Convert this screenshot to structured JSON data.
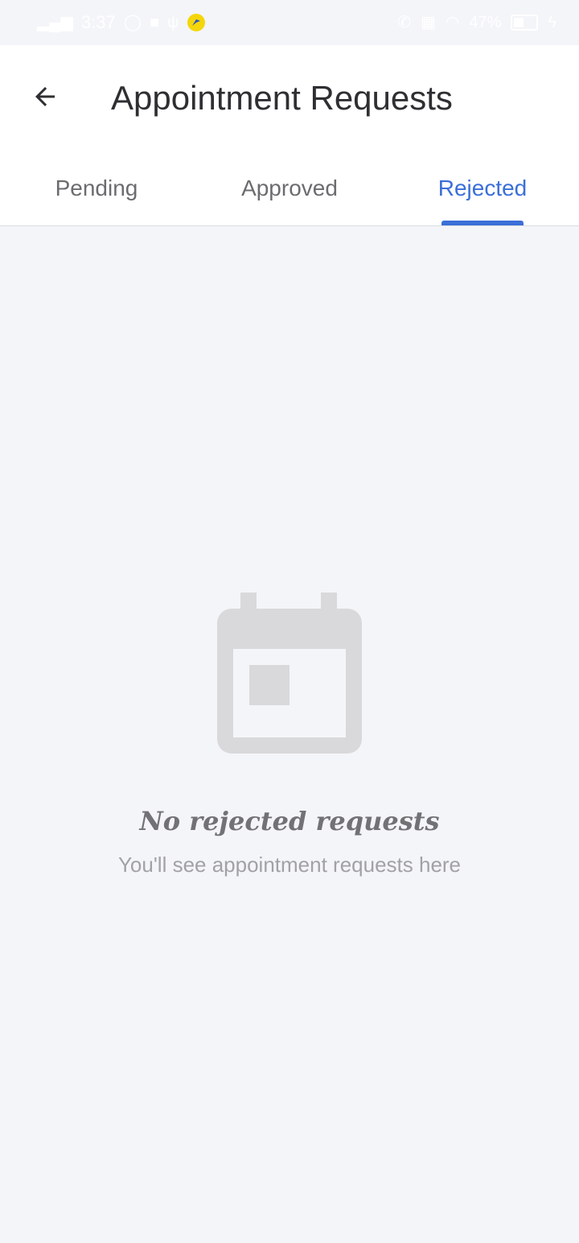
{
  "status_bar": {
    "time": "3:37",
    "battery_percent": "47%"
  },
  "header": {
    "title": "Appointment Requests"
  },
  "tabs": [
    {
      "label": "Pending",
      "active": false
    },
    {
      "label": "Approved",
      "active": false
    },
    {
      "label": "Rejected",
      "active": true
    }
  ],
  "empty_state": {
    "icon": "calendar-icon",
    "title": "No rejected requests",
    "subtitle": "You'll see appointment requests here"
  },
  "colors": {
    "accent": "#3b6fd8",
    "background": "#f4f5f9",
    "icon_gray": "#d9d9db"
  }
}
